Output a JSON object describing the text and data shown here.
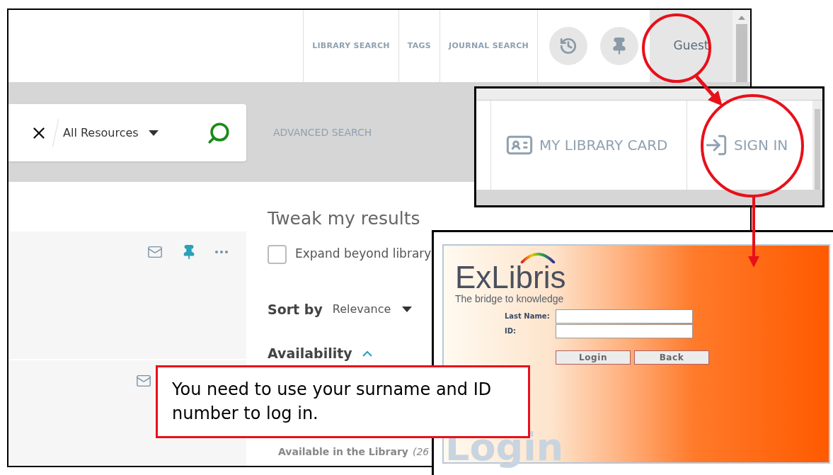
{
  "main_screen": {
    "nav_tabs": [
      {
        "label": "LIBRARY SEARCH"
      },
      {
        "label": "TAGS"
      },
      {
        "label": "JOURNAL SEARCH"
      }
    ],
    "user_button": "Guest",
    "search": {
      "scope": "All Resources"
    },
    "advanced_search": "ADVANCED SEARCH",
    "filters": {
      "title": "Tweak my results",
      "expand_option": {
        "label": "Expand beyond library",
        "checked": false
      },
      "sort_label": "Sort by",
      "sort_value": "Relevance",
      "availability": {
        "heading": "Availability",
        "expanded": true,
        "options": [
          {
            "label": "Available in the Library",
            "count": "(26"
          }
        ]
      }
    }
  },
  "user_menu_inset": {
    "items": [
      {
        "kind": "card",
        "label": "MY LIBRARY CARD"
      },
      {
        "kind": "signin",
        "label": "SIGN IN"
      }
    ]
  },
  "login_inset": {
    "logo": "ExLibris",
    "tagline": "The bridge to knowledge",
    "fields": [
      {
        "label": "Last Name:"
      },
      {
        "label": "ID:"
      }
    ],
    "buttons": [
      "Login",
      "Back"
    ],
    "background_title": "Login"
  },
  "callout": "You need to use your surname and ID number to log in."
}
